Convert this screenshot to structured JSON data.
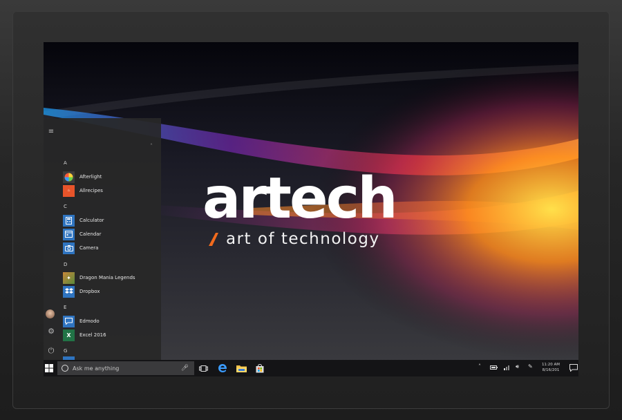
{
  "brand": {
    "name": "artech",
    "tagline": "art of technology",
    "accent_color": "#f26b1d"
  },
  "start_menu": {
    "groups": [
      {
        "letter": "A",
        "apps": [
          {
            "label": "Afterlight",
            "icon": "afterlight-icon",
            "color": "#444"
          },
          {
            "label": "Allrecipes",
            "icon": "allrecipes-icon",
            "color": "#e8542a"
          }
        ]
      },
      {
        "letter": "C",
        "apps": [
          {
            "label": "Calculator",
            "icon": "calculator-icon",
            "color": "#2f74c0"
          },
          {
            "label": "Calendar",
            "icon": "calendar-icon",
            "color": "#2f74c0"
          },
          {
            "label": "Camera",
            "icon": "camera-icon",
            "color": "#2f74c0"
          }
        ]
      },
      {
        "letter": "D",
        "apps": [
          {
            "label": "Dragon Mania Legends",
            "icon": "dragon-mania-legends-icon",
            "color": "#6b8a3a"
          },
          {
            "label": "Dropbox",
            "icon": "dropbox-icon",
            "color": "#2f74c0"
          }
        ]
      },
      {
        "letter": "E",
        "apps": [
          {
            "label": "Edmodo",
            "icon": "edmodo-icon",
            "color": "#2f74c0"
          },
          {
            "label": "Excel 2016",
            "icon": "excel-icon",
            "color": "#217346"
          }
        ]
      },
      {
        "letter": "G",
        "apps": []
      }
    ]
  },
  "taskbar": {
    "search_placeholder": "Ask me anything",
    "clock_time": "11:20 AM",
    "clock_date": "8/16/201"
  }
}
